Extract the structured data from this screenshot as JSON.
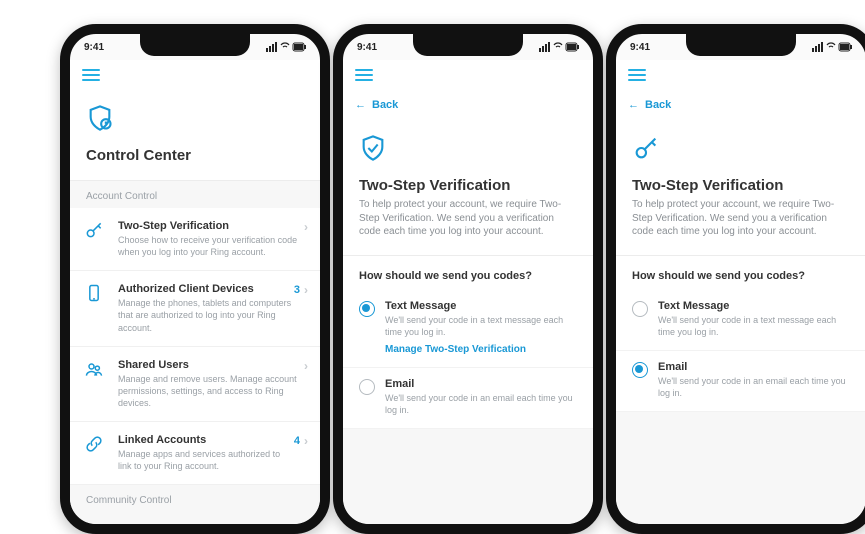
{
  "status": {
    "time": "9:41"
  },
  "nav": {
    "back": "Back"
  },
  "s1": {
    "title": "Control Center",
    "section1": "Account Control",
    "section2": "Community Control",
    "rows": {
      "tsv": {
        "title": "Two-Step Verification",
        "desc": "Choose how to receive your verification code when you log into your Ring account."
      },
      "acd": {
        "title": "Authorized Client Devices",
        "desc": "Manage the phones, tablets and computers that are authorized to log into your Ring account.",
        "count": "3"
      },
      "su": {
        "title": "Shared Users",
        "desc": "Manage and remove users. Manage account permissions, settings, and access to Ring devices."
      },
      "la": {
        "title": "Linked Accounts",
        "desc": "Manage apps and services authorized to link to your Ring account.",
        "count": "4"
      }
    }
  },
  "s2": {
    "title": "Two-Step Verification",
    "desc": "To help protect your account, we require Two-Step Verification. We send you a verification code each time you log into your account.",
    "question": "How should we send you codes?",
    "opts": {
      "text": {
        "title": "Text Message",
        "desc": "We'll send your code in a text message each time you log in.",
        "manage": "Manage Two-Step Verification"
      },
      "email": {
        "title": "Email",
        "desc": "We'll send your code in an email each time you log in."
      }
    }
  }
}
